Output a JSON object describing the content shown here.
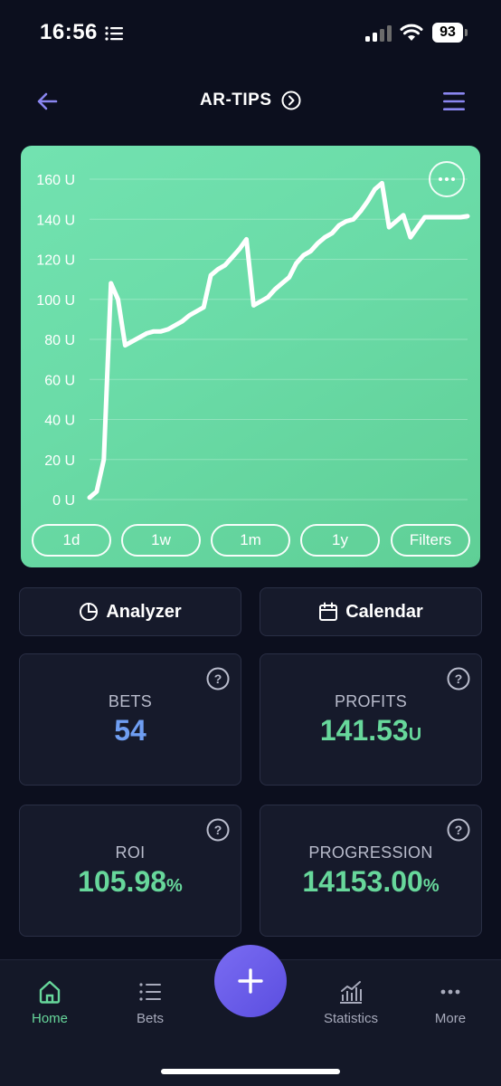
{
  "status_bar": {
    "time": "16:56",
    "battery": "93"
  },
  "header": {
    "title": "AR-TIPS"
  },
  "chart_data": {
    "type": "line",
    "y_tick_labels": [
      "160 U",
      "140 U",
      "120 U",
      "100 U",
      "80 U",
      "60 U",
      "40 U",
      "20 U",
      "0 U"
    ],
    "ylim": [
      0,
      160
    ],
    "grid": true,
    "line_color": "#ffffff",
    "x": [
      0,
      1,
      2,
      3,
      4,
      5,
      6,
      7,
      8,
      9,
      10,
      11,
      12,
      13,
      14,
      15,
      16,
      17,
      18,
      19,
      20,
      21,
      22,
      23,
      24,
      25,
      26,
      27,
      28,
      29,
      30,
      31,
      32,
      33,
      34,
      35,
      36,
      37,
      38,
      39,
      40,
      41,
      42,
      43,
      44,
      45,
      46,
      47,
      48,
      49,
      50,
      51,
      52,
      53
    ],
    "values": [
      1,
      4,
      20,
      108,
      100,
      77,
      79,
      81,
      83,
      84,
      84,
      85,
      87,
      89,
      92,
      94,
      96,
      112,
      115,
      117,
      121,
      125,
      130,
      97,
      99,
      101,
      105,
      108,
      111,
      118,
      122,
      124,
      128,
      131,
      133,
      137,
      139,
      140,
      144,
      149,
      155,
      158,
      136,
      139,
      142,
      131,
      136,
      141,
      141,
      141,
      141,
      141,
      141,
      141.53
    ]
  },
  "range_buttons": [
    "1d",
    "1w",
    "1m",
    "1y",
    "Filters"
  ],
  "actions": {
    "analyzer": "Analyzer",
    "calendar": "Calendar"
  },
  "stats": {
    "bets": {
      "label": "BETS",
      "value": "54"
    },
    "profits": {
      "label": "PROFITS",
      "value": "141.53",
      "unit": "U"
    },
    "roi": {
      "label": "ROI",
      "value": "105.98",
      "unit": "%"
    },
    "progression": {
      "label": "PROGRESSION",
      "value": "14153.00",
      "unit": "%"
    }
  },
  "tabs": [
    {
      "label": "Home",
      "icon": "home-icon",
      "active": true
    },
    {
      "label": "Bets",
      "icon": "list-icon",
      "active": false
    },
    {
      "label": "Statistics",
      "icon": "statistics-icon",
      "active": false
    },
    {
      "label": "More",
      "icon": "more-icon",
      "active": false
    }
  ],
  "colors": {
    "accent_green": "#67d79b",
    "accent_blue": "#6f9ef2",
    "fab": "#6a5ce8",
    "chart_bg": "#6adba7"
  }
}
